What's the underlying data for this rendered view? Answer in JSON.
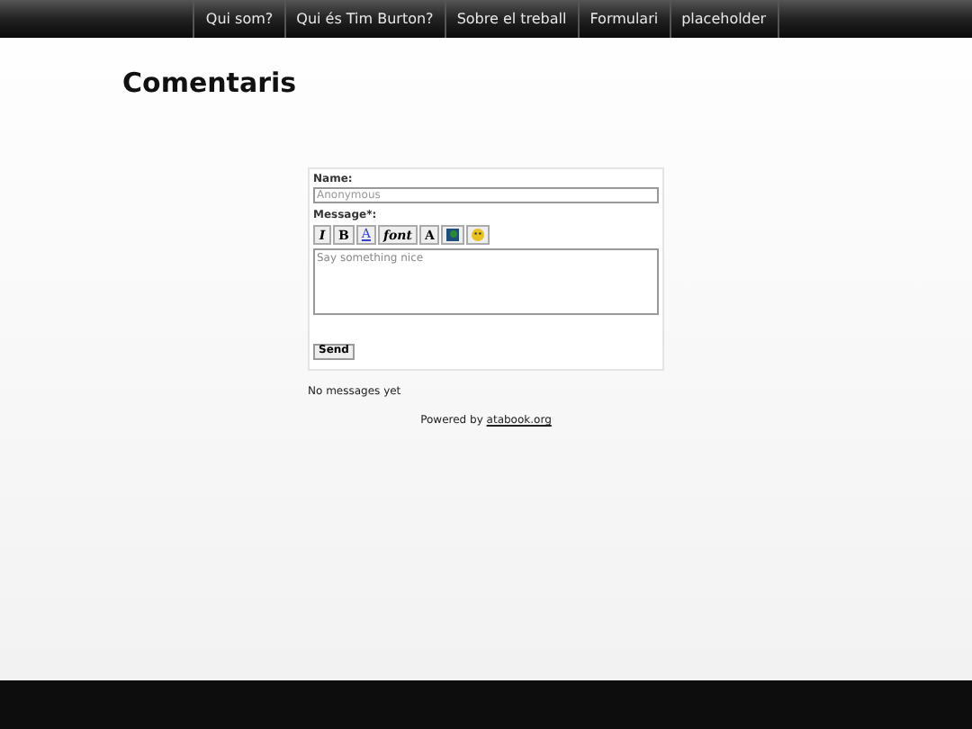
{
  "nav": [
    {
      "label": "Qui som?"
    },
    {
      "label": "Qui és Tim Burton?"
    },
    {
      "label": "Sobre el treball"
    },
    {
      "label": "Formulari"
    },
    {
      "label": "placeholder"
    }
  ],
  "heading": "Comentaris",
  "form": {
    "name_label": "Name:",
    "name_placeholder": "Anonymous",
    "message_label": "Message*:",
    "toolbar": [
      {
        "kind": "italic",
        "label": "I"
      },
      {
        "kind": "bold",
        "label": "B"
      },
      {
        "kind": "color",
        "label": "A"
      },
      {
        "kind": "italic",
        "label": "font"
      },
      {
        "kind": "small",
        "label": "A"
      },
      {
        "kind": "image"
      },
      {
        "kind": "smiley"
      }
    ],
    "message_placeholder": "Say something nice",
    "send": "Send"
  },
  "empty": "No messages yet",
  "powered_prefix": "Powered by",
  "powered_link": "atabook.org"
}
